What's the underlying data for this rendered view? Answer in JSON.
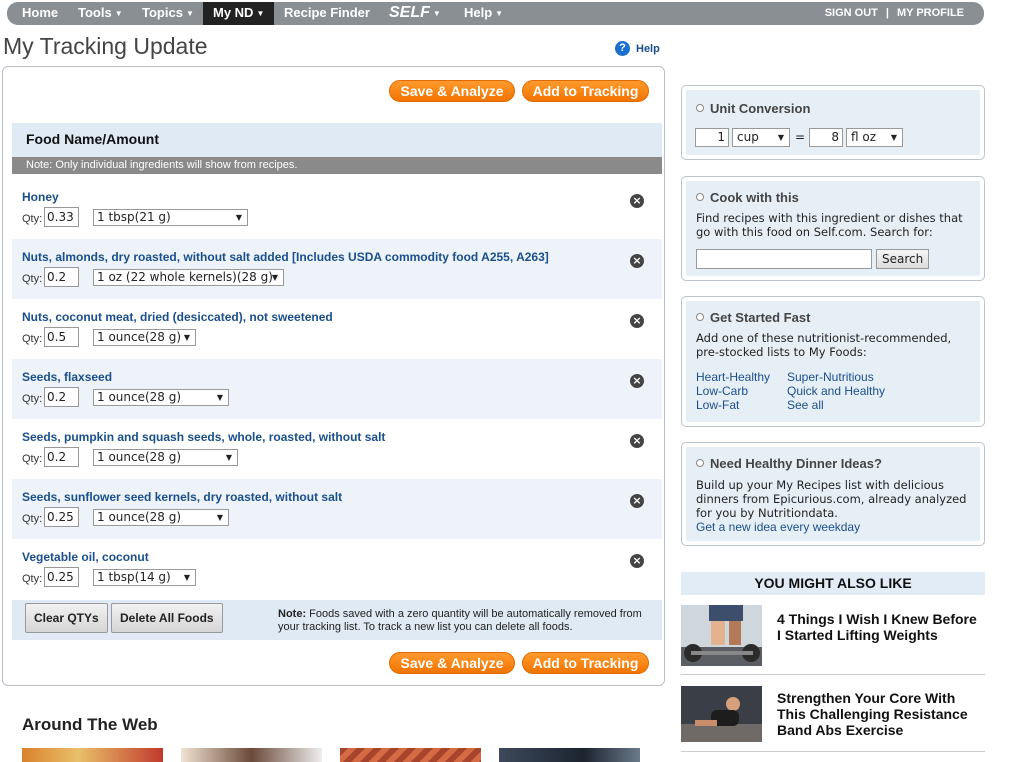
{
  "nav": {
    "items": [
      {
        "label": "Home",
        "caret": false
      },
      {
        "label": "Tools",
        "caret": true
      },
      {
        "label": "Topics",
        "caret": true
      },
      {
        "label": "My ND",
        "caret": true
      },
      {
        "label": "Recipe Finder",
        "caret": false
      },
      {
        "label": "SELF",
        "caret": true
      },
      {
        "label": "Help",
        "caret": true
      }
    ],
    "sign_out": "SIGN OUT",
    "separator": "|",
    "my_profile": "MY PROFILE"
  },
  "page": {
    "title": "My Tracking Update",
    "help_label": "Help",
    "help_icon": "?"
  },
  "tracking": {
    "save_analyze_label": "Save & Analyze",
    "add_to_tracking_label": "Add to Tracking",
    "list_header": "Food Name/Amount",
    "note": "Note: Only individual ingredients will show from recipes.",
    "qty_label": "Qty:",
    "remove_icon": "×",
    "select_arrow": "▼",
    "foods": [
      {
        "name": "Honey",
        "qty": "0.33",
        "unit": "1 tbsp(21 g)"
      },
      {
        "name": "Nuts, almonds, dry roasted, without salt added [Includes USDA commodity food A255, A263]",
        "qty": "0.2",
        "unit": "1 oz (22 whole kernels)(28 g)"
      },
      {
        "name": "Nuts, coconut meat, dried (desiccated), not sweetened",
        "qty": "0.5",
        "unit": "1 ounce(28 g)"
      },
      {
        "name": "Seeds, flaxseed",
        "qty": "0.2",
        "unit": "1 ounce(28 g)"
      },
      {
        "name": "Seeds, pumpkin and squash seeds, whole, roasted, without salt",
        "qty": "0.2",
        "unit": "1 ounce(28 g)"
      },
      {
        "name": "Seeds, sunflower seed kernels, dry roasted, without salt",
        "qty": "0.25",
        "unit": "1 ounce(28 g)"
      },
      {
        "name": "Vegetable oil, coconut",
        "qty": "0.25",
        "unit": "1 tbsp(14 g)"
      }
    ],
    "clear_qtys_label": "Clear QTYs",
    "delete_all_label": "Delete All Foods",
    "footer_note_bold": "Note:",
    "footer_note_text": " Foods saved with a zero quantity will be automatically removed from your tracking list. To track a new list you can delete all foods."
  },
  "around_the_web": {
    "title": "Around The Web"
  },
  "sidebar": {
    "unit_conversion": {
      "title": "Unit Conversion",
      "from_value": "1",
      "from_unit": "cup",
      "equals": "=",
      "to_value": "8",
      "to_unit": "fl oz"
    },
    "cook_with_this": {
      "title": "Cook with this",
      "text": "Find recipes with this ingredient or dishes that go with this food on Self.com. Search for:",
      "search_value": "",
      "search_button": "Search"
    },
    "get_started": {
      "title": "Get Started Fast",
      "text": "Add one of these nutritionist-recommended, pre-stocked lists to My Foods:",
      "links": [
        "Heart-Healthy",
        "Low-Carb",
        "Low-Fat",
        "Super-Nutritious",
        "Quick and Healthy",
        "See all"
      ]
    },
    "dinner_ideas": {
      "title": "Need Healthy Dinner Ideas?",
      "text": "Build up your My Recipes list with delicious dinners from Epicurious.com, already analyzed for you by Nutritiondata.",
      "link": "Get a new idea every weekday"
    },
    "you_might_also_like": {
      "title": "YOU MIGHT ALSO LIKE",
      "articles": [
        {
          "title": "4 Things I Wish I Knew Before I Started Lifting Weights"
        },
        {
          "title": "Strengthen Your Core With This Challenging Resistance Band Abs Exercise"
        }
      ]
    }
  },
  "colors": {
    "nav_bg": "#8a8f94",
    "nav_active": "#222222",
    "accent_orange": "#f27400",
    "link_blue": "#1a4f8b",
    "panel_blue": "#dfeaf4"
  }
}
